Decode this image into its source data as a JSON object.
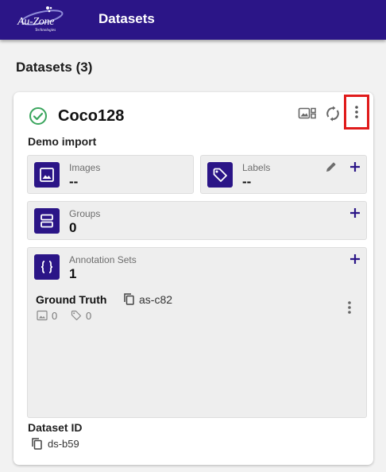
{
  "app": {
    "logo_text": "Au-Zone",
    "logo_subtext": "Technologies",
    "title": "Datasets"
  },
  "page": {
    "heading": "Datasets (3)"
  },
  "dataset": {
    "name": "Coco128",
    "status": "ready",
    "description": "Demo import",
    "stats": {
      "images": {
        "label": "Images",
        "value": "--"
      },
      "labels": {
        "label": "Labels",
        "value": "--"
      },
      "groups": {
        "label": "Groups",
        "value": "0"
      },
      "annotation_sets": {
        "label": "Annotation Sets",
        "value": "1"
      }
    },
    "annotation_set": {
      "name": "Ground Truth",
      "id": "as-c82",
      "image_count": "0",
      "label_count": "0"
    },
    "dataset_id_label": "Dataset ID",
    "dataset_id": "ds-b59"
  },
  "colors": {
    "brand": "#2b1587",
    "success": "#3aa55d",
    "highlight": "#e01b1b"
  },
  "icons": {
    "status": "check-circle-icon",
    "gallery": "gallery-icon",
    "sync": "sync-icon",
    "more": "more-vert-icon",
    "images": "image-icon",
    "labels": "tag-icon",
    "groups": "groups-icon",
    "annotation_sets": "braces-icon",
    "copy": "copy-icon",
    "edit": "pencil-icon",
    "add": "plus-icon"
  }
}
